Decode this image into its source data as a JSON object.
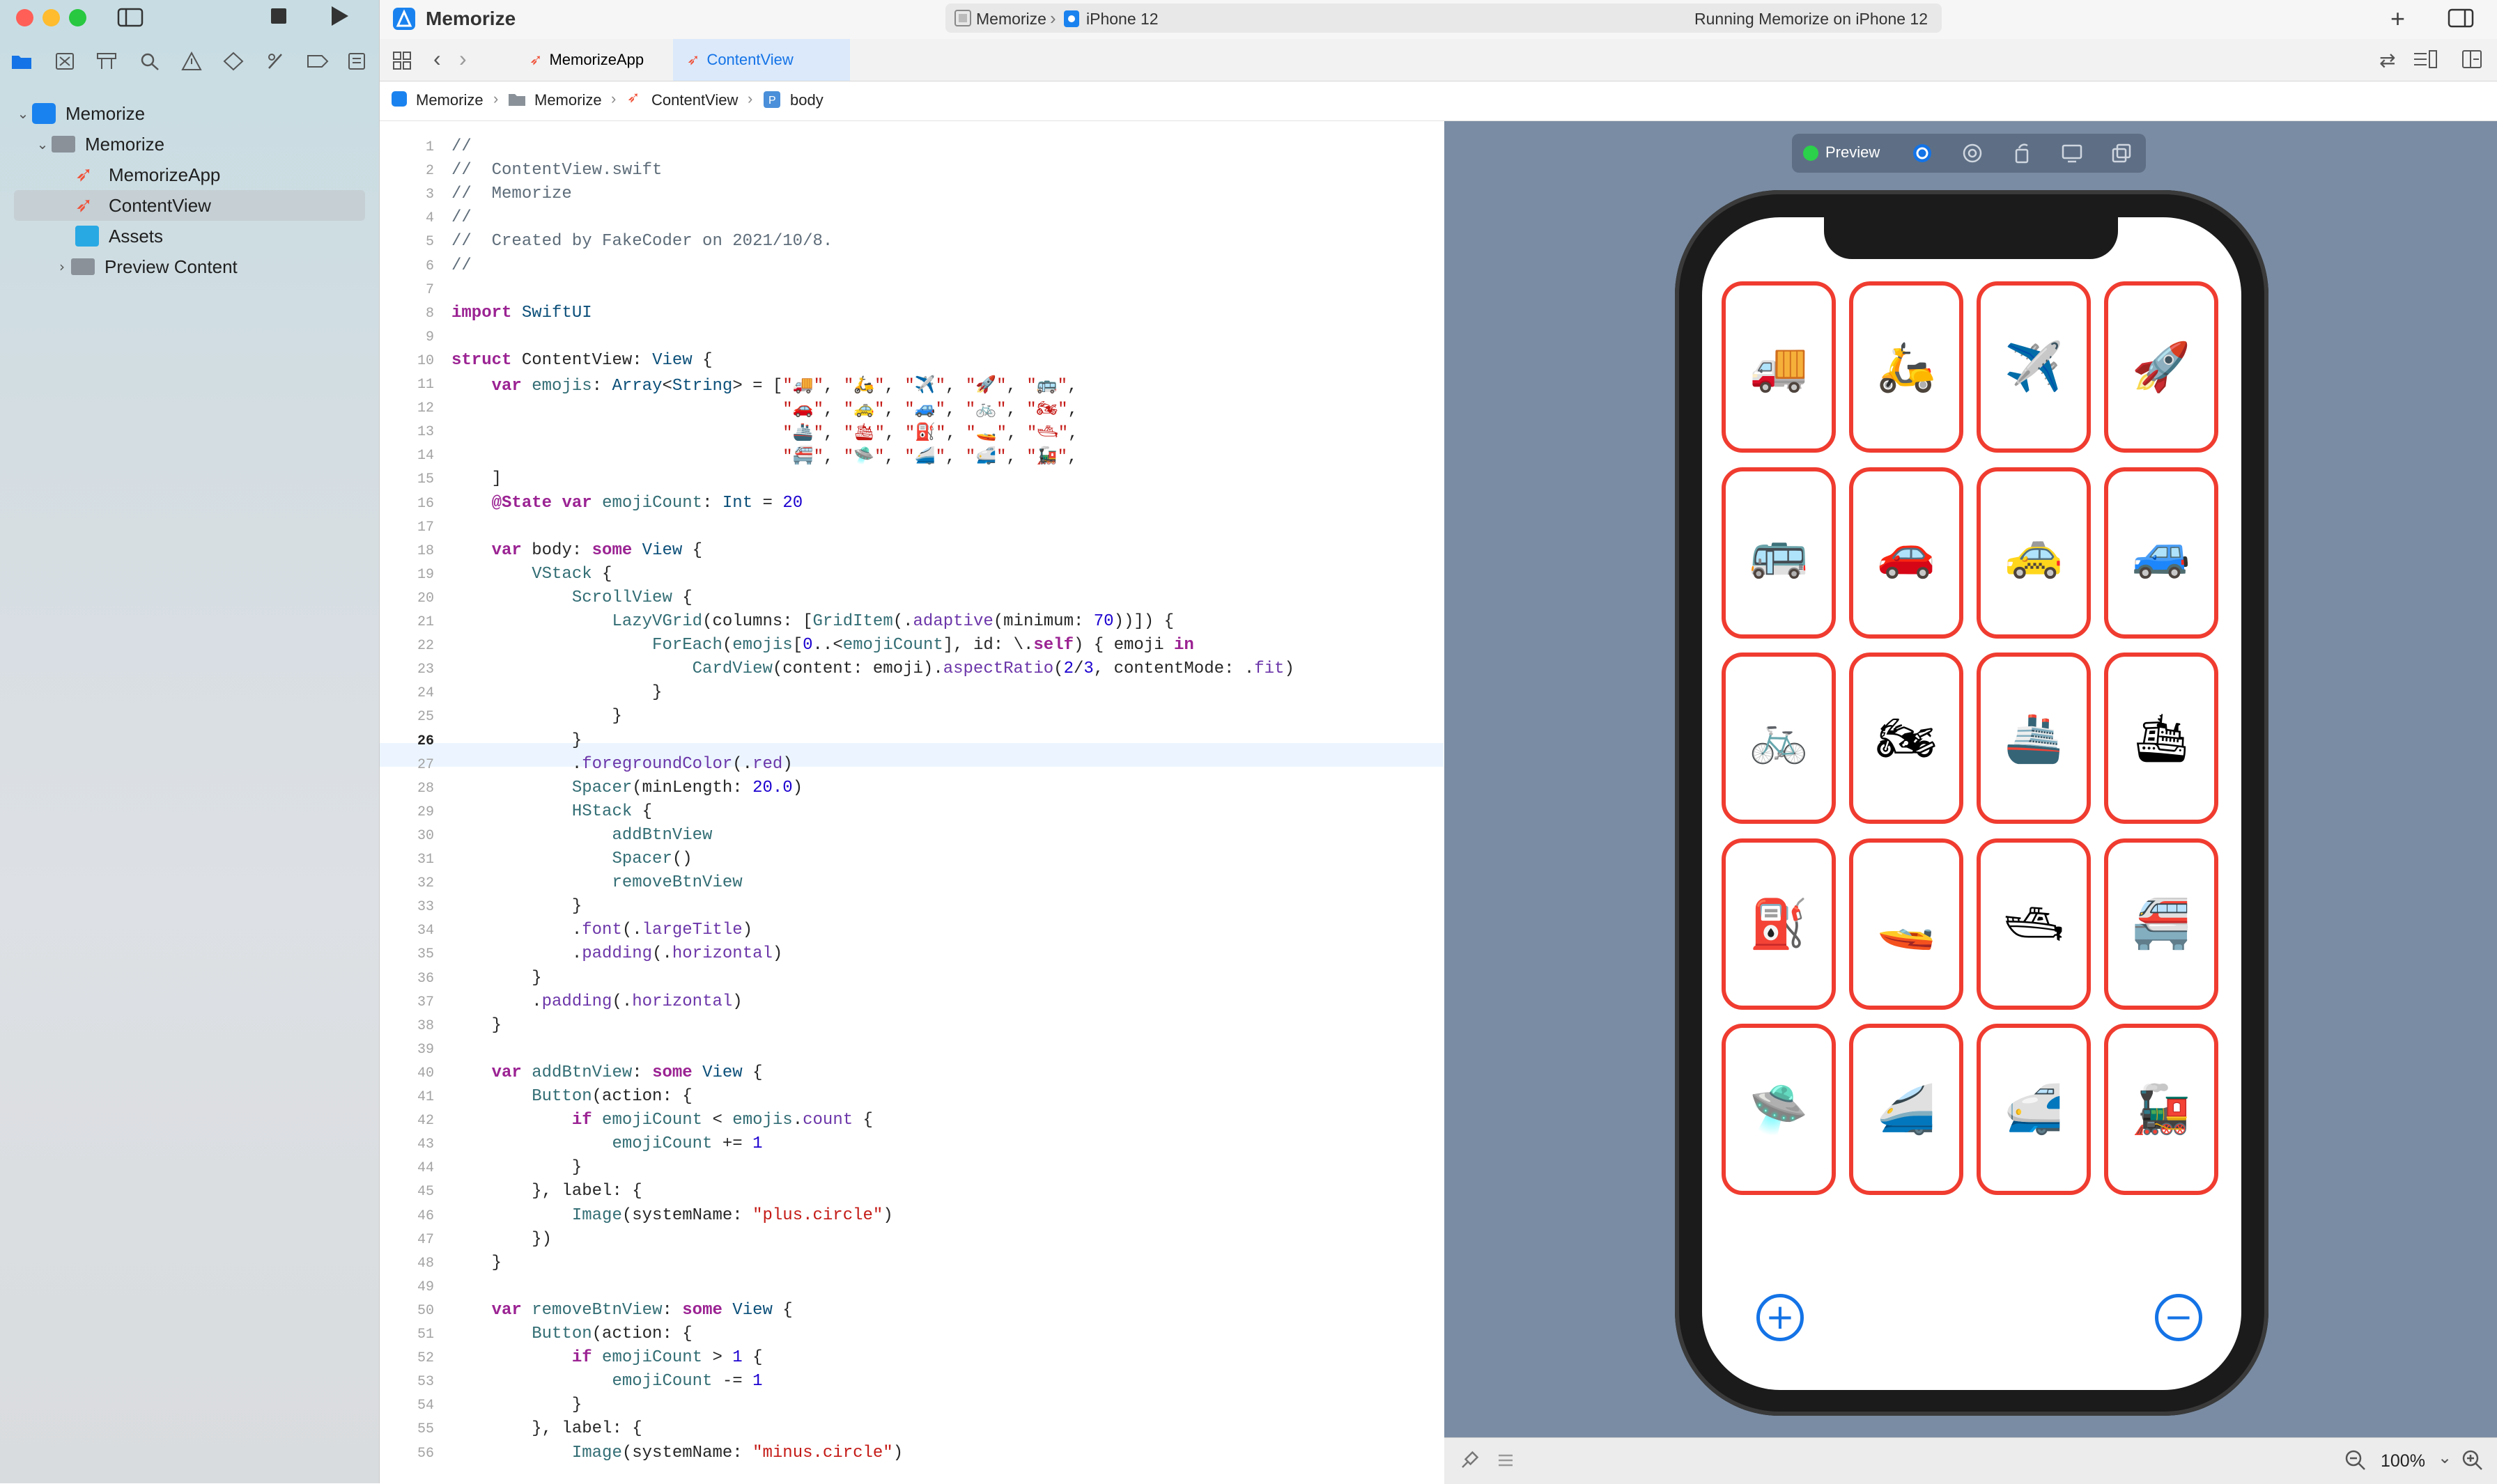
{
  "window": {
    "title": "Memorize",
    "scheme": "Memorize",
    "device": "iPhone 12",
    "status": "Running Memorize on iPhone 12"
  },
  "sidebar": {
    "items": [
      {
        "label": "Memorize",
        "icon": "app-icon"
      },
      {
        "label": "Memorize",
        "icon": "folder-icon"
      },
      {
        "label": "MemorizeApp",
        "icon": "swift-file-icon"
      },
      {
        "label": "ContentView",
        "icon": "swift-file-icon",
        "selected": true
      },
      {
        "label": "Assets",
        "icon": "assets-icon"
      },
      {
        "label": "Preview Content",
        "icon": "folder-icon"
      }
    ]
  },
  "tabs": [
    {
      "label": "MemorizeApp"
    },
    {
      "label": "ContentView",
      "active": true
    }
  ],
  "breadcrumb": [
    "Memorize",
    "Memorize",
    "ContentView",
    "body"
  ],
  "editor": {
    "current_line": 26,
    "lines": [
      {
        "n": "1",
        "t": "//"
      },
      {
        "n": "2",
        "t": "//  ContentView.swift"
      },
      {
        "n": "3",
        "t": "//  Memorize"
      },
      {
        "n": "4",
        "t": "//"
      },
      {
        "n": "5",
        "t": "//  Created by FakeCoder on 2021/10/8."
      },
      {
        "n": "6",
        "t": "//"
      },
      {
        "n": "7",
        "t": ""
      },
      {
        "n": "8",
        "t": "import SwiftUI"
      },
      {
        "n": "9",
        "t": ""
      },
      {
        "n": "10",
        "t": "struct ContentView: View {"
      },
      {
        "n": "11",
        "t": "    var emojis: Array<String> = [\"🚚\", \"🛵\", \"✈️\", \"🚀\", \"🚌\","
      },
      {
        "n": "12",
        "t": "                                 \"🚗\", \"🚕\", \"🚙\", \"🚲\", \"🏍\","
      },
      {
        "n": "13",
        "t": "                                 \"🚢\", \"🛳\", \"⛽️\", \"🚤\", \"🛥\","
      },
      {
        "n": "14",
        "t": "                                 \"🚝\", \"🛸\", \"🚄\", \"🚅\", \"🚂\","
      },
      {
        "n": "15",
        "t": "    ]"
      },
      {
        "n": "16",
        "t": "    @State var emojiCount: Int = 20"
      },
      {
        "n": "17",
        "t": ""
      },
      {
        "n": "18",
        "t": "    var body: some View {"
      },
      {
        "n": "19",
        "t": "        VStack {"
      },
      {
        "n": "20",
        "t": "            ScrollView {"
      },
      {
        "n": "21",
        "t": "                LazyVGrid(columns: [GridItem(.adaptive(minimum: 70))]) {"
      },
      {
        "n": "22",
        "t": "                    ForEach(emojis[0..<emojiCount], id: \\.self) { emoji in"
      },
      {
        "n": "23",
        "t": "                        CardView(content: emoji).aspectRatio(2/3, contentMode: .fit)"
      },
      {
        "n": "24",
        "t": "                    }"
      },
      {
        "n": "25",
        "t": "                }"
      },
      {
        "n": "26",
        "t": "            }"
      },
      {
        "n": "27",
        "t": "            .foregroundColor(.red)"
      },
      {
        "n": "28",
        "t": "            Spacer(minLength: 20.0)"
      },
      {
        "n": "29",
        "t": "            HStack {"
      },
      {
        "n": "30",
        "t": "                addBtnView"
      },
      {
        "n": "31",
        "t": "                Spacer()"
      },
      {
        "n": "32",
        "t": "                removeBtnView"
      },
      {
        "n": "33",
        "t": "            }"
      },
      {
        "n": "34",
        "t": "            .font(.largeTitle)"
      },
      {
        "n": "35",
        "t": "            .padding(.horizontal)"
      },
      {
        "n": "36",
        "t": "        }"
      },
      {
        "n": "37",
        "t": "        .padding(.horizontal)"
      },
      {
        "n": "38",
        "t": "    }"
      },
      {
        "n": "39",
        "t": ""
      },
      {
        "n": "40",
        "t": "    var addBtnView: some View {"
      },
      {
        "n": "41",
        "t": "        Button(action: {"
      },
      {
        "n": "42",
        "t": "            if emojiCount < emojis.count {"
      },
      {
        "n": "43",
        "t": "                emojiCount += 1"
      },
      {
        "n": "44",
        "t": "            }"
      },
      {
        "n": "45",
        "t": "        }, label: {"
      },
      {
        "n": "46",
        "t": "            Image(systemName: \"plus.circle\")"
      },
      {
        "n": "47",
        "t": "        })"
      },
      {
        "n": "48",
        "t": "    }"
      },
      {
        "n": "49",
        "t": ""
      },
      {
        "n": "50",
        "t": "    var removeBtnView: some View {"
      },
      {
        "n": "51",
        "t": "        Button(action: {"
      },
      {
        "n": "52",
        "t": "            if emojiCount > 1 {"
      },
      {
        "n": "53",
        "t": "                emojiCount -= 1"
      },
      {
        "n": "54",
        "t": "            }"
      },
      {
        "n": "55",
        "t": "        }, label: {"
      },
      {
        "n": "56",
        "t": "            Image(systemName: \"minus.circle\")"
      }
    ]
  },
  "preview": {
    "label": "Preview",
    "zoom": "100%",
    "cards": [
      "🚚",
      "🛵",
      "✈️",
      "🚀",
      "🚌",
      "🚗",
      "🚕",
      "🚙",
      "🚲",
      "🏍",
      "🚢",
      "🛳",
      "⛽️",
      "🚤",
      "🛥",
      "🚝",
      "🛸",
      "🚄",
      "🚅",
      "🚂"
    ],
    "add_button": "plus-circle-icon",
    "remove_button": "minus-circle-icon",
    "card_color": "#f03c30",
    "accent_color": "#1473e6"
  }
}
